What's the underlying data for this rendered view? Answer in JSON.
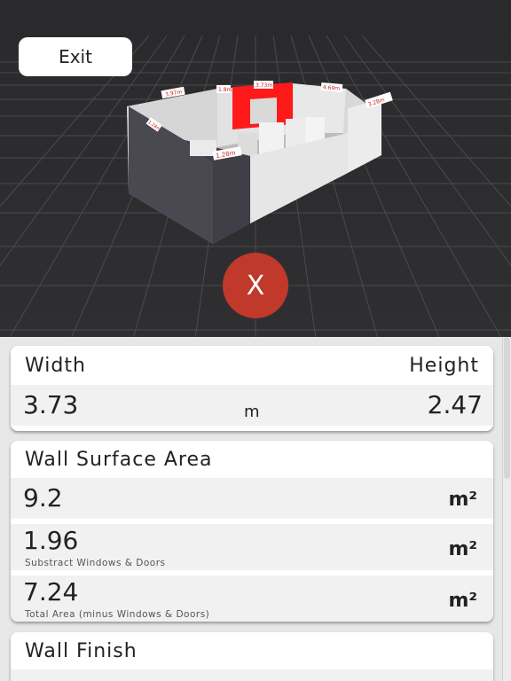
{
  "scene": {
    "exit_label": "Exit",
    "close_label": "X",
    "wall_labels": [
      "3.97m",
      "1.8m",
      "3.73m",
      "4.69m",
      "3.28m",
      "1.28m",
      "1.28m"
    ]
  },
  "dimensions": {
    "width_label": "Width",
    "height_label": "Height",
    "width_value": "3.73",
    "unit": "m",
    "height_value": "2.47"
  },
  "surface": {
    "title": "Wall Surface Area",
    "gross_value": "9.2",
    "gross_unit": "m²",
    "subtract_value": "1.96",
    "subtract_unit": "m²",
    "subtract_note": "Substract Windows & Doors",
    "total_value": "7.24",
    "total_unit": "m²",
    "total_note": "Total Area (minus Windows & Doors)"
  },
  "finish": {
    "title": "Wall Finish"
  },
  "colors": {
    "accent_red": "#c0392b",
    "wall_highlight": "#ff1a1a"
  }
}
